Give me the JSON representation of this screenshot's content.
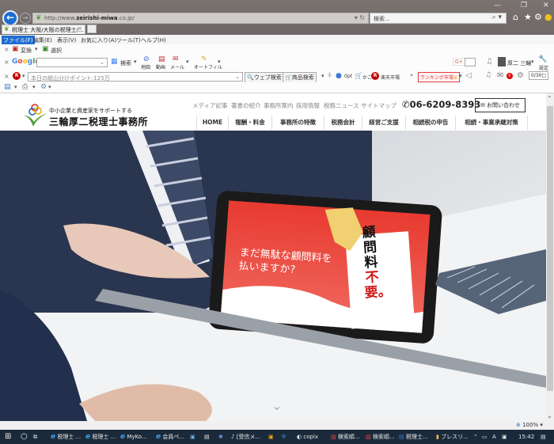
{
  "window": {
    "minimize": "—",
    "restore": "❐",
    "close": "✕"
  },
  "browser": {
    "url_prefix": "http://www.",
    "url_host": "zeirishi-miwa",
    "url_suffix": ".co.jp/",
    "address_controls": "▾ ↻",
    "search_placeholder": "検索...",
    "search_icon": "⌕ ▾",
    "tab_label": "税理士 大阪/大阪の税理士/...",
    "tab_close": "×",
    "nav_icons": [
      "home-icon",
      "favorites-star-icon",
      "settings-gear-icon",
      "smiley-feedback-icon"
    ]
  },
  "menu": [
    {
      "label": "ファイル(F)",
      "active": true
    },
    {
      "label": "編集(E)"
    },
    {
      "label": "表示(V)"
    },
    {
      "label": "お気に入り(A)"
    },
    {
      "label": "ツール(T)"
    },
    {
      "label": "ヘルプ(H)"
    }
  ],
  "toolbar1": {
    "convert": "変換",
    "select": "選択"
  },
  "toolbar2": {
    "google_label": "Google",
    "search": "検索",
    "map": "地図",
    "video": "動画",
    "mail": "メール",
    "autofill": "オートフィル",
    "gplus": "G+",
    "user_name": "厚二 三輪",
    "settings": "設定"
  },
  "toolbar3": {
    "rakuten_input_placeholder": "本日の総山分けポイント:125万",
    "web_search": "ウェブ検索",
    "product_search": "商品検索",
    "points": "0pt",
    "cart": "かご",
    "market": "楽天市場",
    "more": "»",
    "ranking": "ランキング市場",
    "mail_badge": "0",
    "counter": "0/30"
  },
  "site": {
    "logo_tagline": "中小企業と資産家をサポートする",
    "logo_name": "三輪厚二税理士事務所",
    "top_links": [
      "メディア記事",
      "著書の紹介",
      "事務所案内",
      "採用情報",
      "税務ニュース",
      "サイトマップ"
    ],
    "phone": "06-6209-8393",
    "contact": "お問い合わせ",
    "nav": [
      "HOME",
      "報酬・料金",
      "事務所の特徴",
      "税務会計",
      "経営ご支援",
      "相続税の申告",
      "相続・事業承継対策"
    ]
  },
  "hero": {
    "tablet_line1": "まだ無駄な顧問料を",
    "tablet_line2": "払いますか?",
    "sign_black": "顧問料",
    "sign_red": "不要。",
    "scroll_down": "⌄"
  },
  "status": {
    "zoom": "100%"
  },
  "taskbar": {
    "items": [
      "税理士 ...",
      "税理士 ...",
      "MyKo...",
      "会員ペ...",
      "[受信メ...",
      "copix",
      "検索順...",
      "検索順...",
      "税理士...",
      "ブレスリ..."
    ],
    "time": "15:42"
  },
  "colors": {
    "accent_blue": "#1f6cd1",
    "tablet_red": "#e03030",
    "taskbar": "#1b2a3a"
  }
}
